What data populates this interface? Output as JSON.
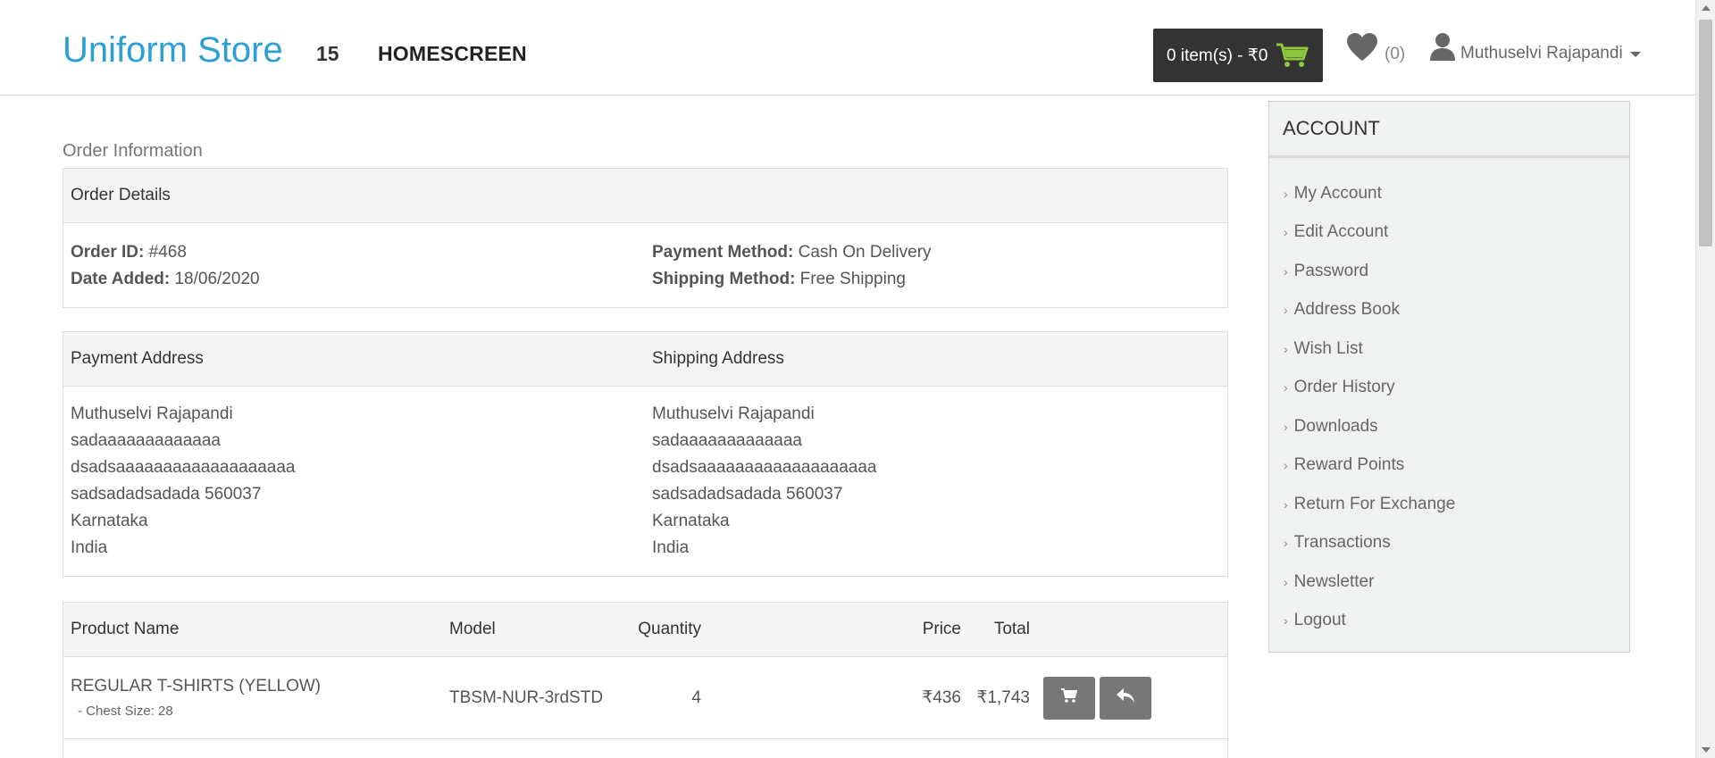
{
  "header": {
    "brand": "Uniform Store",
    "nav_number": "15",
    "nav_home": "HOMESCREEN",
    "cart_label": "0 item(s) - ₹0",
    "wishlist_count": "(0)",
    "user_name": "Muthuselvi Rajapandi"
  },
  "colors": {
    "brand": "#2c9fd6",
    "cart_bg": "#333333",
    "cart_icon": "#8dc63f"
  },
  "order": {
    "heading": "Order Information",
    "details_title": "Order Details",
    "order_id_label": "Order ID:",
    "order_id_value": " #468",
    "date_label": "Date Added:",
    "date_value": " 18/06/2020",
    "payment_method_label": "Payment Method:",
    "payment_method_value": " Cash On Delivery",
    "shipping_method_label": "Shipping Method:",
    "shipping_method_value": " Free Shipping"
  },
  "addresses": {
    "payment_title": "Payment Address",
    "shipping_title": "Shipping Address",
    "payment_lines": [
      "Muthuselvi Rajapandi",
      "sadaaaaaaaaaaaaa",
      "dsadsaaaaaaaaaaaaaaaaaaa",
      "sadsadadsadada 560037",
      "Karnataka",
      "India"
    ],
    "shipping_lines": [
      "Muthuselvi Rajapandi",
      "sadaaaaaaaaaaaaa",
      "dsadsaaaaaaaaaaaaaaaaaaa",
      "sadsadadsadada 560037",
      "Karnataka",
      "India"
    ]
  },
  "products": {
    "headers": {
      "name": "Product Name",
      "model": "Model",
      "quantity": "Quantity",
      "price": "Price",
      "total": "Total"
    },
    "rows": [
      {
        "name": "REGULAR T-SHIRTS (YELLOW)",
        "option": "- Chest Size: 28",
        "model": "TBSM-NUR-3rdSTD",
        "quantity": "4",
        "price": "₹436",
        "total": "₹1,743"
      }
    ]
  },
  "sidebar": {
    "title": "ACCOUNT",
    "items": [
      {
        "label": "My Account"
      },
      {
        "label": "Edit Account"
      },
      {
        "label": "Password"
      },
      {
        "label": "Address Book"
      },
      {
        "label": "Wish List"
      },
      {
        "label": "Order History"
      },
      {
        "label": "Downloads"
      },
      {
        "label": "Reward Points"
      },
      {
        "label": "Return For Exchange"
      },
      {
        "label": "Transactions"
      },
      {
        "label": "Newsletter"
      },
      {
        "label": "Logout"
      }
    ]
  },
  "icons": {
    "cart": "cart-icon",
    "heart": "heart-icon",
    "user": "user-icon",
    "chevron": "chevron-right-icon",
    "reorder": "cart-icon",
    "return": "reply-icon"
  }
}
